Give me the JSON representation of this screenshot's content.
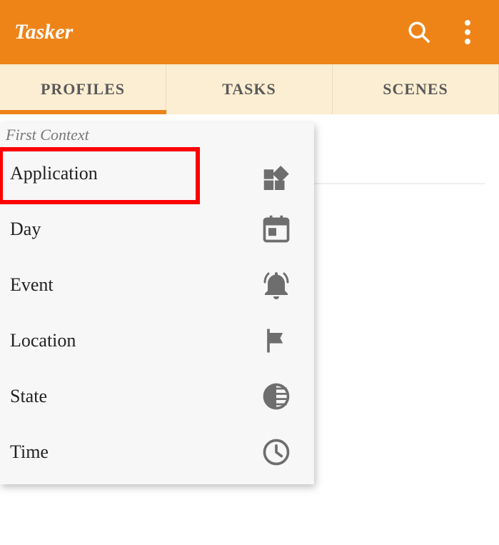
{
  "header": {
    "title": "Tasker"
  },
  "tabs": {
    "items": [
      "PROFILES",
      "TASKS",
      "SCENES"
    ],
    "active_index": 0
  },
  "menu": {
    "title": "First Context",
    "items": [
      {
        "label": "Application",
        "icon": "apps",
        "highlighted": true
      },
      {
        "label": "Day",
        "icon": "calendar"
      },
      {
        "label": "Event",
        "icon": "bell"
      },
      {
        "label": "Location",
        "icon": "flag"
      },
      {
        "label": "State",
        "icon": "contrast"
      },
      {
        "label": "Time",
        "icon": "clock"
      }
    ]
  }
}
